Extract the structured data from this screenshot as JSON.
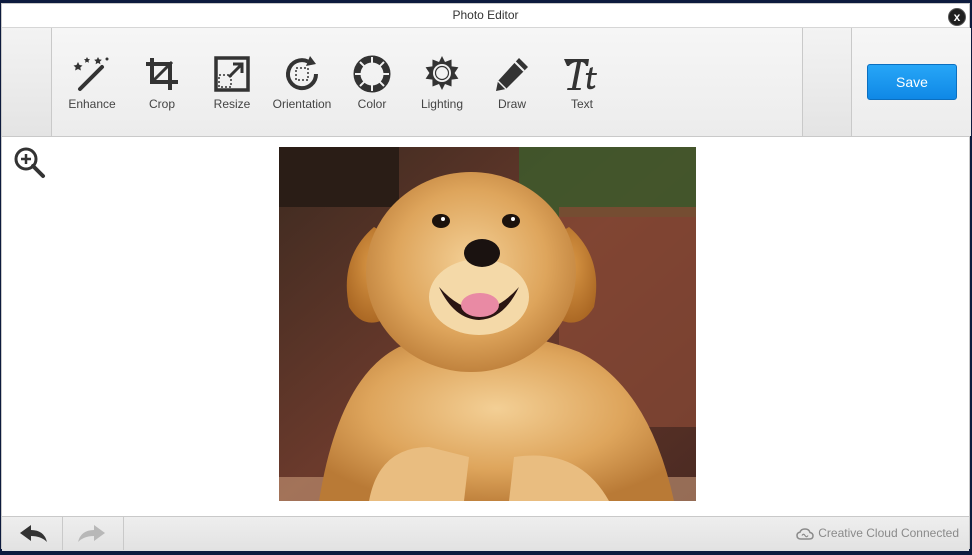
{
  "window": {
    "title": "Photo Editor",
    "close_label": "x"
  },
  "toolbar": {
    "tools": [
      {
        "label": "Enhance",
        "icon": "magic-wand-icon"
      },
      {
        "label": "Crop",
        "icon": "crop-icon"
      },
      {
        "label": "Resize",
        "icon": "resize-icon"
      },
      {
        "label": "Orientation",
        "icon": "rotate-icon"
      },
      {
        "label": "Color",
        "icon": "color-wheel-icon"
      },
      {
        "label": "Lighting",
        "icon": "sun-icon"
      },
      {
        "label": "Draw",
        "icon": "pencil-icon"
      },
      {
        "label": "Text",
        "icon": "text-icon"
      }
    ],
    "save_label": "Save"
  },
  "canvas": {
    "zoom_icon": "zoom-in-icon",
    "image_subject": "golden retriever puppy"
  },
  "bottombar": {
    "undo_icon": "undo-icon",
    "redo_icon": "redo-icon",
    "cc_label": "Creative Cloud Connected"
  },
  "colors": {
    "accent": "#1996ef",
    "toolbar_bg": "#eeeeee",
    "icon": "#333333",
    "background": "#0d1b3e"
  }
}
